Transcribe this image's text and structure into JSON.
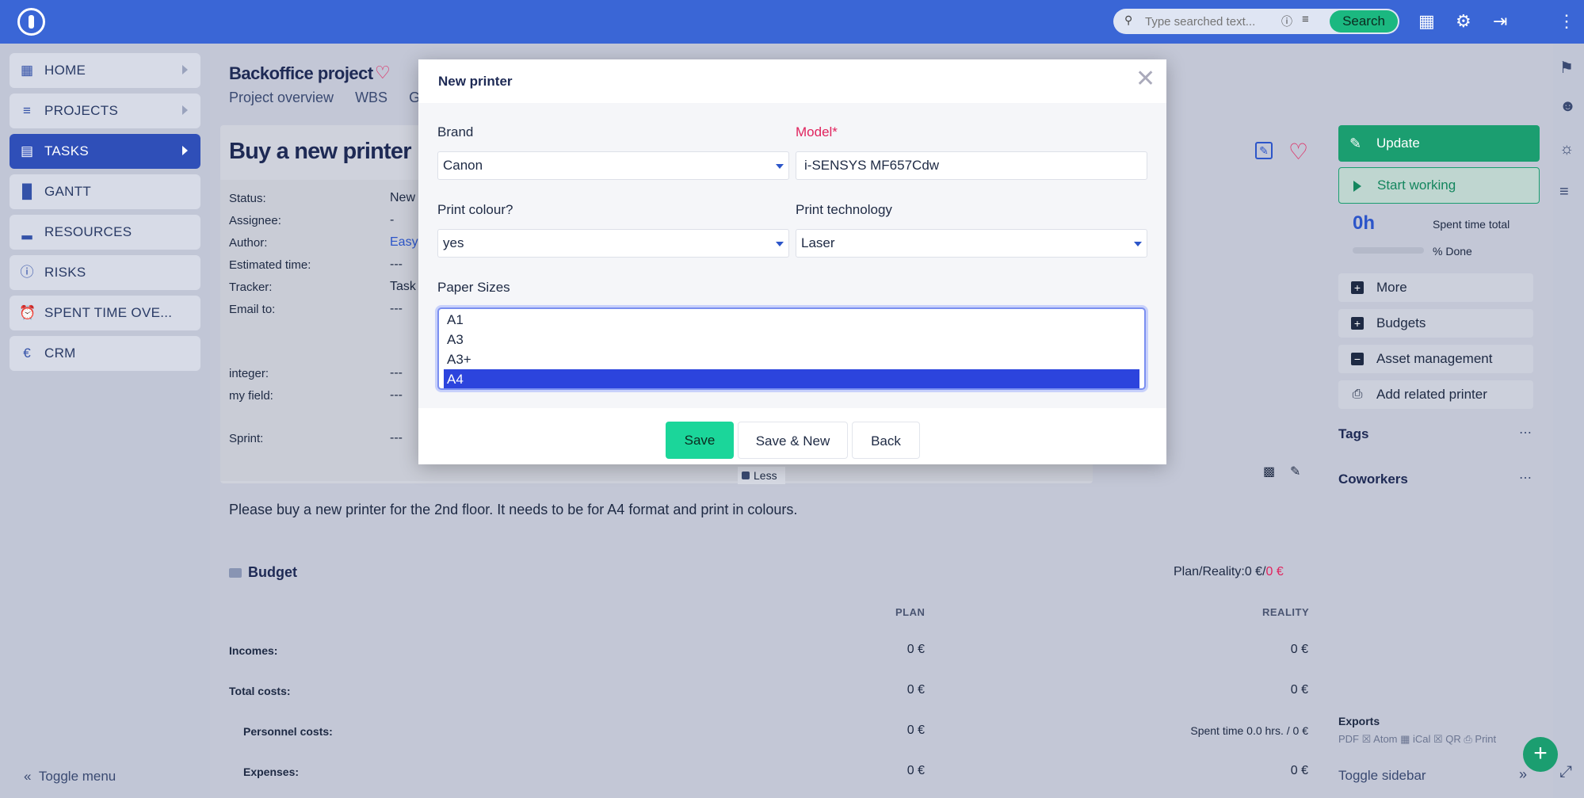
{
  "topbar": {
    "search_placeholder": "Type searched text...",
    "search_button": "Search"
  },
  "sidebar": {
    "items": [
      {
        "label": "HOME",
        "icon": "grid-icon"
      },
      {
        "label": "PROJECTS",
        "icon": "tree-icon"
      },
      {
        "label": "TASKS",
        "icon": "clipboard-icon"
      },
      {
        "label": "GANTT",
        "icon": "gantt-icon"
      },
      {
        "label": "RESOURCES",
        "icon": "bar-chart-icon"
      },
      {
        "label": "RISKS",
        "icon": "alert-icon"
      },
      {
        "label": "SPENT TIME OVE...",
        "icon": "alarm-clock-icon"
      },
      {
        "label": "CRM",
        "icon": "euro-icon"
      }
    ],
    "toggle_menu": "Toggle menu"
  },
  "project": {
    "title": "Backoffice project",
    "tabs": [
      "Project overview",
      "WBS",
      "G"
    ]
  },
  "task": {
    "title": "Buy a new printer",
    "attributes": [
      {
        "label": "Status:",
        "value": "New"
      },
      {
        "label": "Assignee:",
        "value": "-"
      },
      {
        "label": "Author:",
        "value": "Easy"
      },
      {
        "label": "Estimated time:",
        "value": "---"
      },
      {
        "label": "Tracker:",
        "value": "Task"
      },
      {
        "label": "Email to:",
        "value": "---"
      },
      {
        "label": "integer:",
        "value": "---"
      },
      {
        "label": "my field:",
        "value": "---"
      },
      {
        "label": "Sprint:",
        "value": "---"
      }
    ],
    "less_label": "Less",
    "description": "Please buy a new printer for the 2nd floor. It needs to be for A4 format and print in colours."
  },
  "budget": {
    "title": "Budget",
    "plan_reality_label": "Plan/Reality:",
    "plan_reality_plan": "0 €/",
    "plan_reality_real": "0 €",
    "col_plan": "PLAN",
    "col_reality": "REALITY",
    "rows": [
      {
        "label": "Incomes:",
        "plan": "0 €",
        "reality": "0 €"
      },
      {
        "label": "Total costs:",
        "plan": "0 €",
        "reality": "0 €"
      },
      {
        "label": "Personnel costs:",
        "plan": "0 €",
        "reality": "Spent time 0.0 hrs. / 0 €"
      },
      {
        "label": "Expenses:",
        "plan": "0 €",
        "reality": "0 €"
      }
    ]
  },
  "right_sidebar": {
    "update_button": "Update",
    "start_button": "Start working",
    "spent_value": "0h",
    "spent_label": "Spent time total",
    "done_label": "% Done",
    "done_percent": 0,
    "items": [
      "More",
      "Budgets",
      "Asset management",
      "Add related printer"
    ],
    "tags": "Tags",
    "coworkers": "Coworkers",
    "exports_title": "Exports",
    "export_links": "PDF ☒ Atom ▦ iCal ☒ QR ⎙ Print",
    "toggle_sidebar": "Toggle sidebar"
  },
  "modal": {
    "title": "New printer",
    "brand_label": "Brand",
    "brand_value": "Canon",
    "model_label": "Model*",
    "model_value": "i-SENSYS MF657Cdw",
    "print_colour_label": "Print colour?",
    "print_colour_value": "yes",
    "print_tech_label": "Print technology",
    "print_tech_value": "Laser",
    "paper_sizes_label": "Paper Sizes",
    "paper_sizes": [
      "A1",
      "A3",
      "A3+",
      "A4"
    ],
    "save": "Save",
    "save_new": "Save & New",
    "back": "Back"
  }
}
